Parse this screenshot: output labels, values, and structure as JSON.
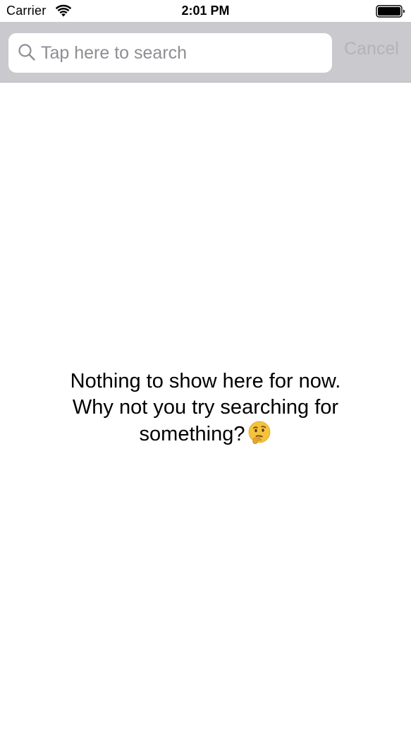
{
  "status_bar": {
    "carrier": "Carrier",
    "time": "2:01 PM",
    "wifi_icon": "wifi-icon",
    "battery_icon": "battery-full-icon"
  },
  "search": {
    "placeholder": "Tap here to search",
    "value": "",
    "cancel_label": "Cancel",
    "icon": "magnifying-glass-icon"
  },
  "empty_state": {
    "line1": "Nothing to show here for now.",
    "line2": "Why not you try searching for",
    "line3": "something?",
    "emoji": "thinking-face-emoji"
  },
  "colors": {
    "search_bar_bg": "#c9c9ce",
    "placeholder": "#8e8e93",
    "cancel_disabled": "#b3b3b8",
    "emoji_face": "#f5c33b"
  }
}
